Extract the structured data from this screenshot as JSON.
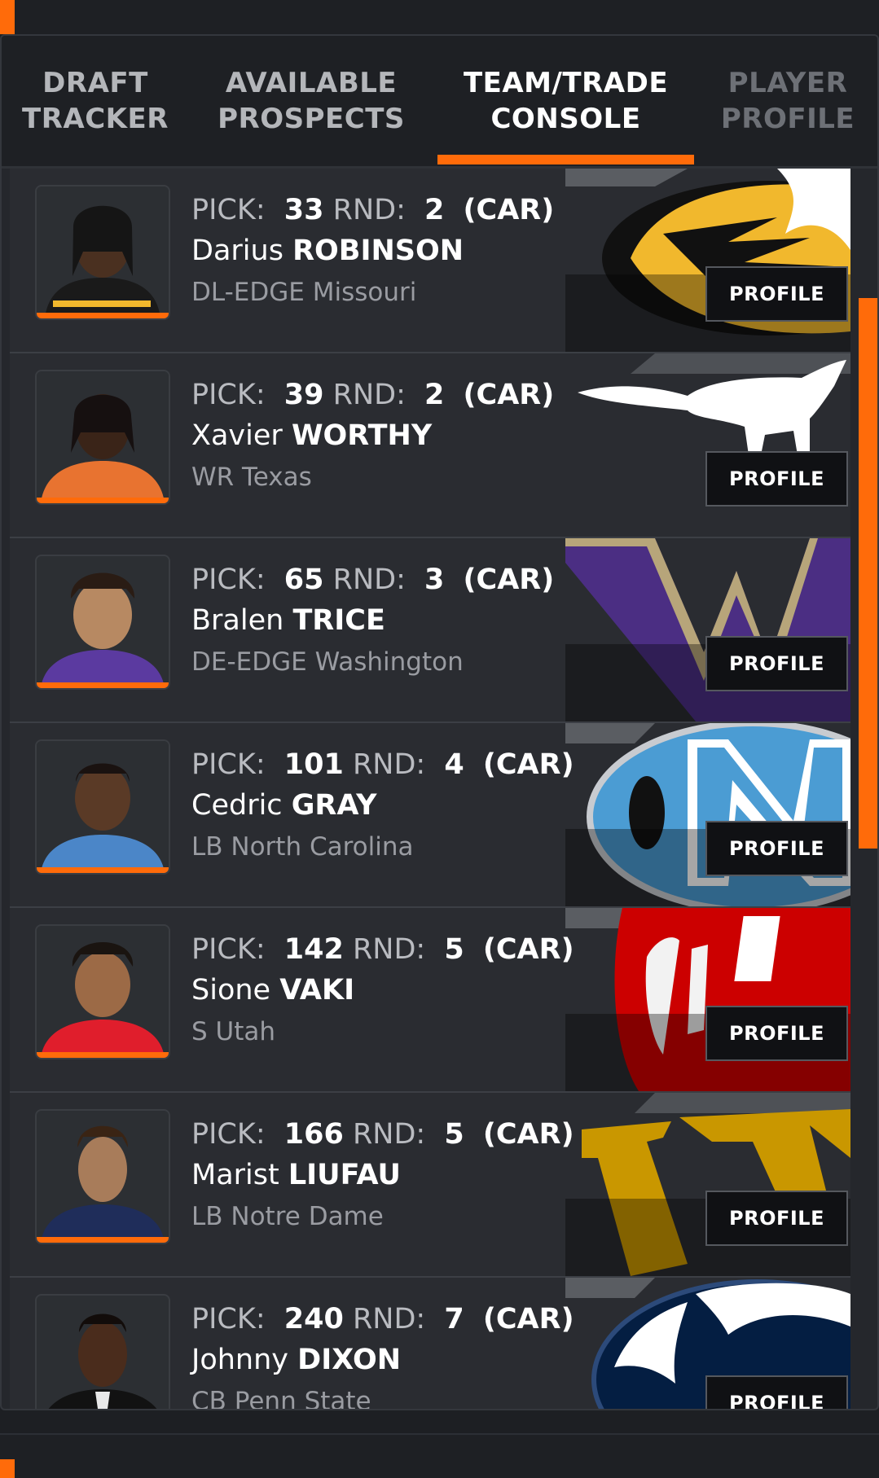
{
  "tabs": [
    {
      "line1": "DRAFT",
      "line2": "TRACKER",
      "active": false
    },
    {
      "line1": "AVAILABLE",
      "line2": "PROSPECTS",
      "active": false
    },
    {
      "line1": "TEAM/TRADE",
      "line2": "CONSOLE",
      "active": true
    },
    {
      "line1": "PLAYER",
      "line2": "PROFILE",
      "active": false
    }
  ],
  "labels": {
    "pick": "PICK:",
    "rnd": "RND:",
    "profile": "PROFILE"
  },
  "accent_color": "#ff6b0a",
  "picks": [
    {
      "pick": "33",
      "round": "2",
      "team": "(CAR)",
      "first": "Darius",
      "last": "ROBINSON",
      "position_school": "DL-EDGE Missouri",
      "school_logo": "missouri-tiger-logo"
    },
    {
      "pick": "39",
      "round": "2",
      "team": "(CAR)",
      "first": "Xavier",
      "last": "WORTHY",
      "position_school": "WR Texas",
      "school_logo": "texas-longhorn-logo"
    },
    {
      "pick": "65",
      "round": "3",
      "team": "(CAR)",
      "first": "Bralen",
      "last": "TRICE",
      "position_school": "DE-EDGE Washington",
      "school_logo": "washington-w-logo"
    },
    {
      "pick": "101",
      "round": "4",
      "team": "(CAR)",
      "first": "Cedric",
      "last": "GRAY",
      "position_school": "LB North Carolina",
      "school_logo": "unc-logo"
    },
    {
      "pick": "142",
      "round": "5",
      "team": "(CAR)",
      "first": "Sione",
      "last": "VAKI",
      "position_school": "S Utah",
      "school_logo": "utah-u-logo"
    },
    {
      "pick": "166",
      "round": "5",
      "team": "(CAR)",
      "first": "Marist",
      "last": "LIUFAU",
      "position_school": "LB Notre Dame",
      "school_logo": "notre-dame-nd-logo"
    },
    {
      "pick": "240",
      "round": "7",
      "team": "(CAR)",
      "first": "Johnny",
      "last": "DIXON",
      "position_school": "CB Penn State",
      "school_logo": "penn-state-lion-logo"
    }
  ]
}
